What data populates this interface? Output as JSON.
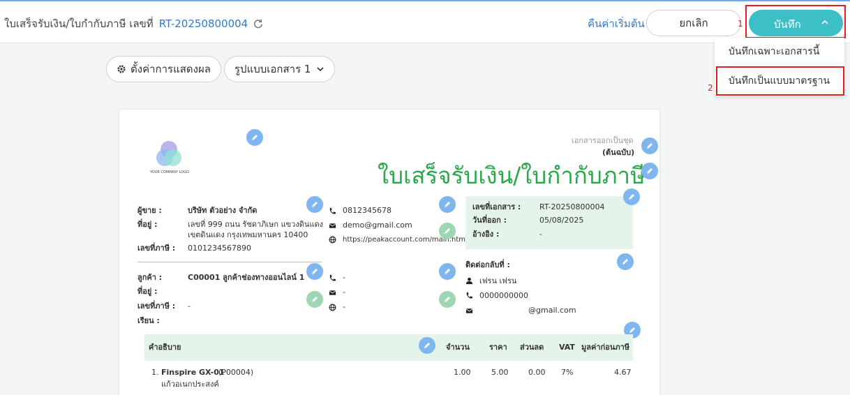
{
  "header": {
    "title": "ใบเสร็จรับเงิน/ใบกำกับภาษี เลขที่",
    "doc_number": "RT-20250800004",
    "reset_label": "คืนค่าเริ่มต้น",
    "cancel_label": "ยกเลิก",
    "save_label": "บันทึก"
  },
  "annotations": {
    "step1": "1",
    "step2": "2"
  },
  "save_menu": {
    "items": [
      "บันทึกเฉพาะเอกสารนี้",
      "บันทึกเป็นแบบมาตรฐาน"
    ]
  },
  "toolbar": {
    "display_settings_label": "ตั้งค่าการแสดงผล",
    "format_label": "รูปแบบเอกสาร 1"
  },
  "document": {
    "logo_text": "YOUR COMPANY LOGO",
    "set_note": "เอกสารออกเป็นชุด",
    "copy_label": "(ต้นฉบับ)",
    "title": "ใบเสร็จรับเงิน/ใบกำกับภาษี",
    "seller": {
      "label": "ผู้ขาย :",
      "name": "บริษัท ตัวอย่าง จำกัด",
      "address_label": "ที่อยู่ :",
      "address_line1": "เลขที่ 999 ถนน รัชดาภิเษก แขวงดินแดง",
      "address_line2": "เขตดินแดง กรุงเทพมหานคร 10400",
      "tax_label": "เลขที่ภาษี :",
      "tax_id": "0101234567890",
      "phone": "0812345678",
      "email": "demo@gmail.com",
      "website": "https://peakaccount.com/main.html"
    },
    "doc_info": {
      "number_label": "เลขที่เอกสาร :",
      "number": "RT-20250800004",
      "date_label": "วันที่ออก :",
      "date": "05/08/2025",
      "ref_label": "อ้างอิง :",
      "ref": "-"
    },
    "customer": {
      "label": "ลูกค้า :",
      "name": "C00001 ลูกค้าช่องทางออนไลน์ 1",
      "address_label": "ที่อยู่ :",
      "tax_label": "เลขที่ภาษี :",
      "tax_id": "-",
      "attn_label": "เรียน :",
      "phone": "-",
      "email": "-",
      "website": "-"
    },
    "contact": {
      "label": "ติดต่อกลับที่ :",
      "name": "เฟรน เฟรน",
      "phone": "0000000000",
      "email": "@gmail.com"
    },
    "table": {
      "columns": [
        "คำอธิบาย",
        "จำนวน",
        "ราคา",
        "ส่วนลด",
        "VAT",
        "มูลค่าก่อนภาษี"
      ],
      "rows": [
        {
          "no": "1.",
          "name": "Finspire GX-01",
          "code": "(P00004)",
          "desc": "แก้วอเนกประสงค์",
          "qty": "1.00",
          "price": "5.00",
          "discount": "0.00",
          "vat": "7%",
          "amount": "4.67"
        }
      ]
    }
  },
  "colors": {
    "accent": "#3dbfc8",
    "link": "#2f7ccf",
    "title_green": "#2aa84a",
    "highlight": "#e02020"
  }
}
